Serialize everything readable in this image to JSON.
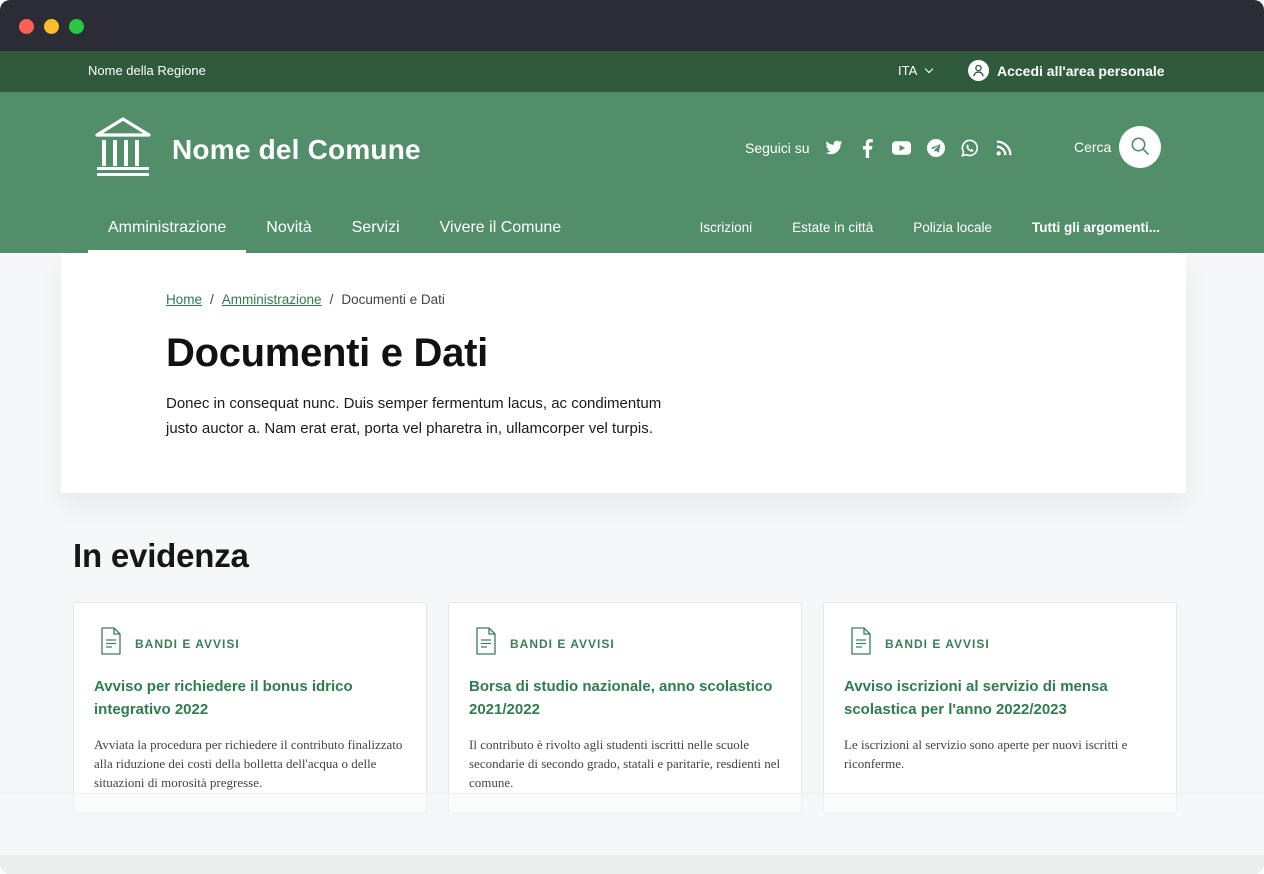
{
  "slim_header": {
    "region": "Nome della Regione",
    "language": "ITA",
    "login": "Accedi all'area personale"
  },
  "header": {
    "municipality": "Nome del Comune",
    "follow_label": "Seguici su",
    "social": [
      "twitter-icon",
      "facebook-icon",
      "youtube-icon",
      "telegram-icon",
      "whatsapp-icon",
      "rss-icon"
    ],
    "search_label": "Cerca"
  },
  "nav": {
    "main": [
      {
        "label": "Amministrazione",
        "active": true
      },
      {
        "label": "Novità",
        "active": false
      },
      {
        "label": "Servizi",
        "active": false
      },
      {
        "label": "Vivere il Comune",
        "active": false
      }
    ],
    "secondary": [
      {
        "label": "Iscrizioni"
      },
      {
        "label": "Estate in città"
      },
      {
        "label": "Polizia locale"
      },
      {
        "label": "Tutti gli argomenti..."
      }
    ]
  },
  "breadcrumb": {
    "home": "Home",
    "section": "Amministrazione",
    "current": "Documenti e Dati",
    "separator": "/"
  },
  "page": {
    "title": "Documenti e Dati",
    "description": "Donec in consequat nunc. Duis semper fermentum lacus, ac condimentum justo auctor a. Nam erat erat, porta vel pharetra in, ullamcorper vel turpis."
  },
  "highlights": {
    "title": "In evidenza",
    "cards": [
      {
        "category": "BANDI E AVVISI",
        "title": "Avviso per richiedere il bonus idrico integrativo 2022",
        "text": "Avviata la procedura per richiedere il contributo finalizzato alla riduzione dei costi della bolletta dell'acqua o delle situazioni di morosità pregresse."
      },
      {
        "category": "BANDI E AVVISI",
        "title": "Borsa di studio nazionale, anno scolastico 2021/2022",
        "text": "Il contributo è rivolto agli studenti iscritti nelle scuole secondarie di secondo grado, statali e paritarie, resdienti nel comune."
      },
      {
        "category": "BANDI E AVVISI",
        "title": "Avviso iscrizioni al servizio di mensa scolastica per l'anno 2022/2023",
        "text": "Le iscrizioni al servizio sono aperte per nuovi iscritti e riconferme."
      }
    ]
  },
  "colors": {
    "primary": "#528e69",
    "dark": "#2f5a3b",
    "link": "#2f7d4f"
  }
}
